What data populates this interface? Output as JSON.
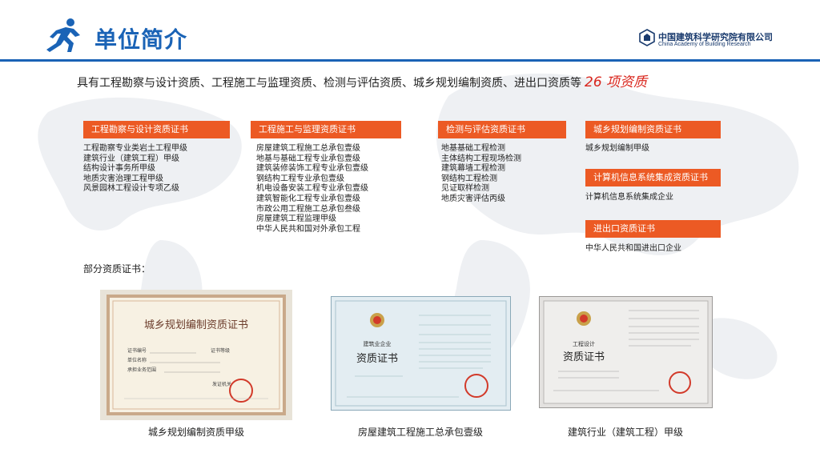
{
  "header": {
    "title": "单位简介",
    "logo_cn": "中国建筑科学研究院有限公司",
    "logo_en": "China Academy of Building Research"
  },
  "headline": {
    "text": "具有工程勘察与设计资质、工程施工与监理资质、检测与评估资质、城乡规划编制资质、进出口资质等",
    "highlight": "26 项资质"
  },
  "categories": [
    {
      "title": "工程勘察与设计资质证书",
      "items": [
        "工程勘察专业类岩土工程甲级",
        "建筑行业（建筑工程）甲级",
        "结构设计事务所甲级",
        "地质灾害治理工程甲级",
        "风景园林工程设计专项乙级"
      ]
    },
    {
      "title": "工程施工与监理资质证书",
      "items": [
        "房屋建筑工程施工总承包壹级",
        "地基与基础工程专业承包壹级",
        "建筑装修装饰工程专业承包壹级",
        "钢结构工程专业承包壹级",
        "机电设备安装工程专业承包壹级",
        "建筑智能化工程专业承包壹级",
        "市政公用工程施工总承包叁级",
        "房屋建筑工程监理甲级",
        "中华人民共和国对外承包工程"
      ]
    },
    {
      "title": "检测与评估资质证书",
      "items": [
        "地基基础工程检测",
        "主体结构工程现场检测",
        "建筑幕墙工程检测",
        "钢结构工程检测",
        "见证取样检测",
        "地质灾害评估丙级"
      ]
    },
    {
      "title": "城乡规划编制资质证书",
      "items": [
        "城乡规划编制甲级"
      ]
    },
    {
      "title": "计算机信息系统集成资质证书",
      "items": [
        "计算机信息系统集成企业"
      ]
    },
    {
      "title": "进出口资质证书",
      "items": [
        "中华人民共和国进出口企业"
      ]
    }
  ],
  "certs_caption": "部分资质证书：",
  "certificates": [
    {
      "label": "城乡规划编制资质甲级",
      "doc_title": "城乡规划编制资质证书",
      "fields": [
        "证书编号",
        "单位名称",
        "承担业务范围",
        "证书等级",
        "发证机关"
      ]
    },
    {
      "label": "房屋建筑工程施工总承包壹级",
      "doc_header": "建筑业企业",
      "doc_title": "资质证书"
    },
    {
      "label": "建筑行业（建筑工程）甲级",
      "doc_header": "工程设计",
      "doc_title": "资质证书"
    }
  ],
  "colors": {
    "brand_blue": "#1a63b6",
    "category_orange": "#ec5a24",
    "highlight_red": "#d9251c"
  }
}
